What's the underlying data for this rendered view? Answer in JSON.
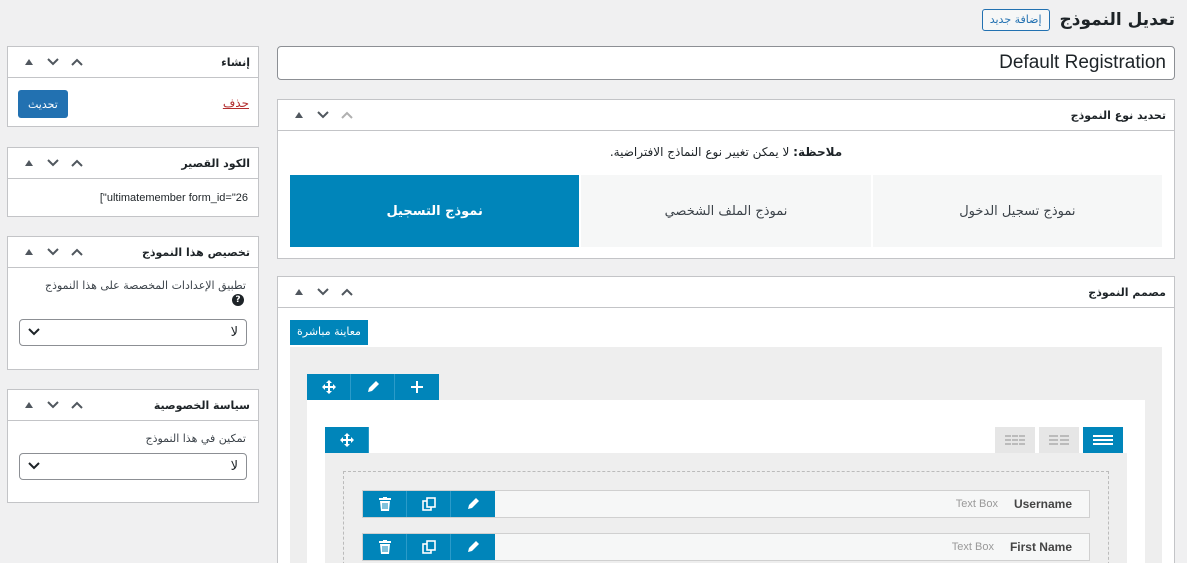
{
  "header": {
    "title": "تعديل النموذج",
    "add_new": "إضافة جديد"
  },
  "form_title": "Default Registration",
  "form_type_box": {
    "title": "تحديد نوع النموذج",
    "note_bold": "ملاحظة:",
    "note_text": " لا يمكن تغيير نوع النماذج الافتراضية.",
    "tiles": [
      "نموذج تسجيل الدخول",
      "نموذج الملف الشخصي",
      "نموذج التسجيل"
    ],
    "active_tile": 2
  },
  "builder_box": {
    "title": "مصمم النموذج",
    "live_preview": "معاينة مباشرة",
    "fields": [
      {
        "label": "Username",
        "type": "Text Box"
      },
      {
        "label": "First Name",
        "type": "Text Box"
      }
    ]
  },
  "sidebar": {
    "publish": {
      "title": "إنشاء",
      "update": "تحديث",
      "delete": "حذف"
    },
    "shortcode": {
      "title": "الكود القصير",
      "value": "[\"ultimatemember form_id=\"26"
    },
    "customize": {
      "title": "تخصيص هذا النموذج",
      "label": "تطبيق الإعدادات المخصصة على هذا النموذج",
      "help": "?",
      "value": "لا"
    },
    "privacy": {
      "title": "سياسة الخصوصية",
      "label": "تمكين في هذا النموذج",
      "value": "لا"
    }
  },
  "colors": {
    "accent": "#0085ba",
    "primary_button": "#2271b1",
    "delete_link": "#b32d2e"
  }
}
